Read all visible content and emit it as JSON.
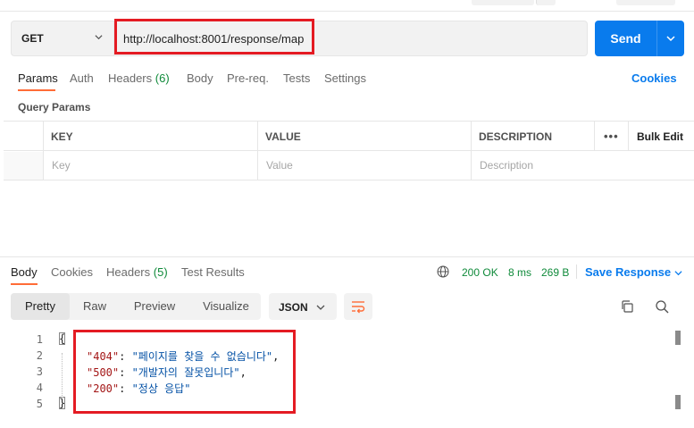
{
  "request": {
    "method": "GET",
    "url": "http://localhost:8001/response/map",
    "send_label": "Send"
  },
  "request_tabs": [
    {
      "label": "Params",
      "active": true
    },
    {
      "label": "Auth"
    },
    {
      "label": "Headers",
      "count": "(6)"
    },
    {
      "label": "Body"
    },
    {
      "label": "Pre-req."
    },
    {
      "label": "Tests"
    },
    {
      "label": "Settings"
    }
  ],
  "cookies_label": "Cookies",
  "query_params_title": "Query Params",
  "params_table": {
    "headers": {
      "key": "KEY",
      "value": "VALUE",
      "description": "DESCRIPTION",
      "more": "•••",
      "bulk_edit": "Bulk Edit"
    },
    "placeholders": {
      "key": "Key",
      "value": "Value",
      "description": "Description"
    }
  },
  "response_tabs": [
    {
      "label": "Body",
      "active": true
    },
    {
      "label": "Cookies"
    },
    {
      "label": "Headers",
      "count": "(5)"
    },
    {
      "label": "Test Results"
    }
  ],
  "response_meta": {
    "status": "200 OK",
    "time": "8 ms",
    "size": "269 B",
    "save_label": "Save Response"
  },
  "view_options": [
    "Pretty",
    "Raw",
    "Preview",
    "Visualize"
  ],
  "selected_view": "Pretty",
  "format": "JSON",
  "code": {
    "line_numbers": [
      "1",
      "2",
      "3",
      "4",
      "5"
    ],
    "open_brace": "{",
    "close_brace": "}",
    "entries": [
      {
        "key": "\"404\"",
        "value": "\"페이지를 찾을 수 없습니다\"",
        "trail": ","
      },
      {
        "key": "\"500\"",
        "value": "\"개발자의 잘못입니다\"",
        "trail": ","
      },
      {
        "key": "\"200\"",
        "value": "\"정상 응답\"",
        "trail": ""
      }
    ]
  },
  "colors": {
    "accent_blue": "#097bed",
    "tab_underline": "#ff6c37",
    "success_green": "#0f8a3a",
    "highlight_red": "#e41b23"
  },
  "icons": [
    "chevron-down-icon",
    "globe-icon",
    "wrap-lines-icon",
    "copy-icon",
    "search-icon"
  ]
}
